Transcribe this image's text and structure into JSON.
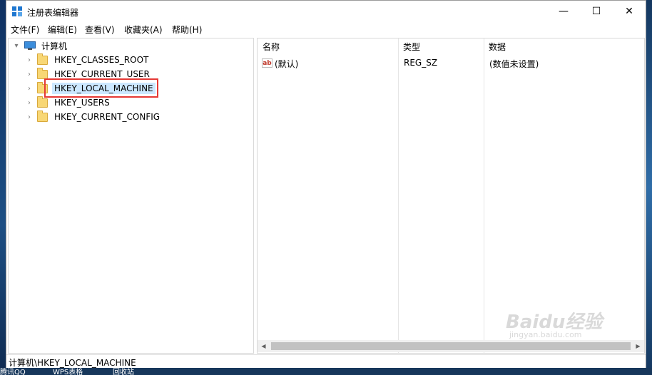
{
  "window": {
    "title": "注册表编辑器",
    "controls": {
      "minimize": "—",
      "maximize": "☐",
      "close": "✕"
    }
  },
  "menu": [
    "文件(F)",
    "编辑(E)",
    "查看(V)",
    "收藏夹(A)",
    "帮助(H)"
  ],
  "tree": {
    "root": "计算机",
    "keys": [
      {
        "label": "HKEY_CLASSES_ROOT",
        "selected": false
      },
      {
        "label": "HKEY_CURRENT_USER",
        "selected": false
      },
      {
        "label": "HKEY_LOCAL_MACHINE",
        "selected": true
      },
      {
        "label": "HKEY_USERS",
        "selected": false
      },
      {
        "label": "HKEY_CURRENT_CONFIG",
        "selected": false
      }
    ]
  },
  "list": {
    "columns": {
      "name": "名称",
      "type": "类型",
      "data": "数据"
    },
    "rows": [
      {
        "icon": "ab",
        "name": "(默认)",
        "type": "REG_SZ",
        "data": "(数值未设置)"
      }
    ]
  },
  "status": {
    "path": "计算机\\HKEY_LOCAL_MACHINE"
  },
  "watermark": {
    "main": "Baidu经验",
    "sub": "jingyan.baidu.com"
  },
  "taskbar": [
    "腾讯QQ",
    "WPS表格",
    "回收站"
  ],
  "colors": {
    "selection": "#cce8ff",
    "highlight_box": "#e53935",
    "folder": "#f8d775"
  }
}
